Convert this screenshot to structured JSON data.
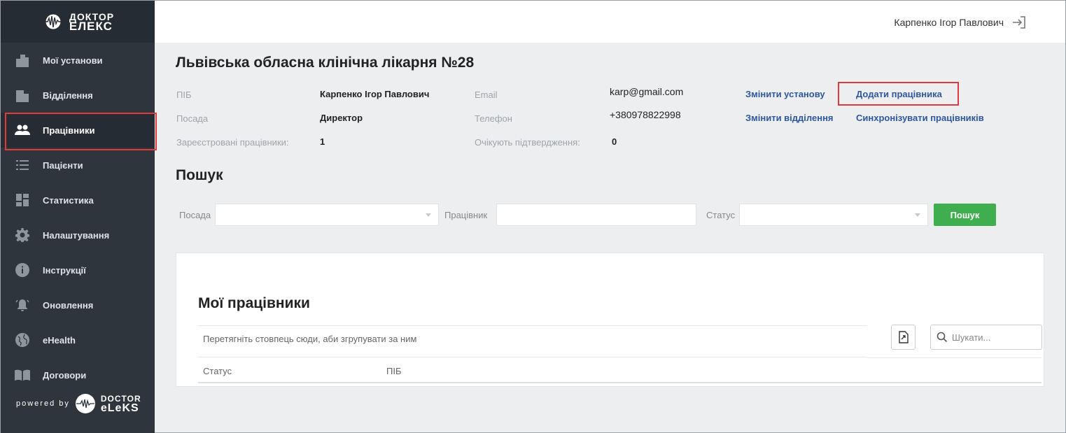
{
  "brand": {
    "line1": "ДОКТОР",
    "line2": "ЕЛЕКС"
  },
  "sidebar": {
    "items": [
      {
        "label": "Мої установи",
        "icon": "buildings-icon",
        "active": false
      },
      {
        "label": "Відділення",
        "icon": "building-icon",
        "active": false
      },
      {
        "label": "Працівники",
        "icon": "people-icon",
        "active": true
      },
      {
        "label": "Пацієнти",
        "icon": "list-icon",
        "active": false
      },
      {
        "label": "Статистика",
        "icon": "dashboard-icon",
        "active": false
      },
      {
        "label": "Налаштування",
        "icon": "gear-icon",
        "active": false
      },
      {
        "label": "Інструкції",
        "icon": "info-icon",
        "active": false
      },
      {
        "label": "Оновлення",
        "icon": "bell-icon",
        "active": false
      },
      {
        "label": "eHealth",
        "icon": "globe-icon",
        "active": false
      },
      {
        "label": "Договори",
        "icon": "book-icon",
        "active": false
      }
    ],
    "powered_by": "powered by",
    "footer_brand": {
      "line1": "DOCTOR",
      "line2": "eLeKS"
    }
  },
  "header": {
    "user_name": "Карпенко Ігор Павлович"
  },
  "org": {
    "title": "Львівська обласна клінічна лікарня №28",
    "pib_label": "ПІБ",
    "pib_value": "Карпенко Ігор Павлович",
    "position_label": "Посада",
    "position_value": "Директор",
    "registered_label": "Зареєстровані працівники:",
    "registered_value": "1",
    "email_label": "Email",
    "email_value": "karp@gmail.com",
    "phone_label": "Телефон",
    "phone_value": "+380978822998",
    "pending_label": "Очікують підтвердження:",
    "pending_value": "0",
    "links": {
      "change_org": "Змінити установу",
      "add_worker": "Додати працівника",
      "change_dept": "Змінити відділення",
      "sync_workers": "Синхронізувати працівників"
    }
  },
  "search": {
    "title": "Пошук",
    "position_label": "Посада",
    "worker_label": "Працівник",
    "status_label": "Статус",
    "button": "Пошук"
  },
  "grid": {
    "title": "Мої працівники",
    "group_hint": "Перетягніть стовпець сюди, аби згрупувати за ним",
    "search_placeholder": "Шукати...",
    "columns": [
      "Статус",
      "ПІБ"
    ]
  },
  "colors": {
    "accent": "#3fae4f",
    "link": "#2f56a0",
    "highlight": "#e0393e",
    "sidebar": "#2e353d"
  }
}
